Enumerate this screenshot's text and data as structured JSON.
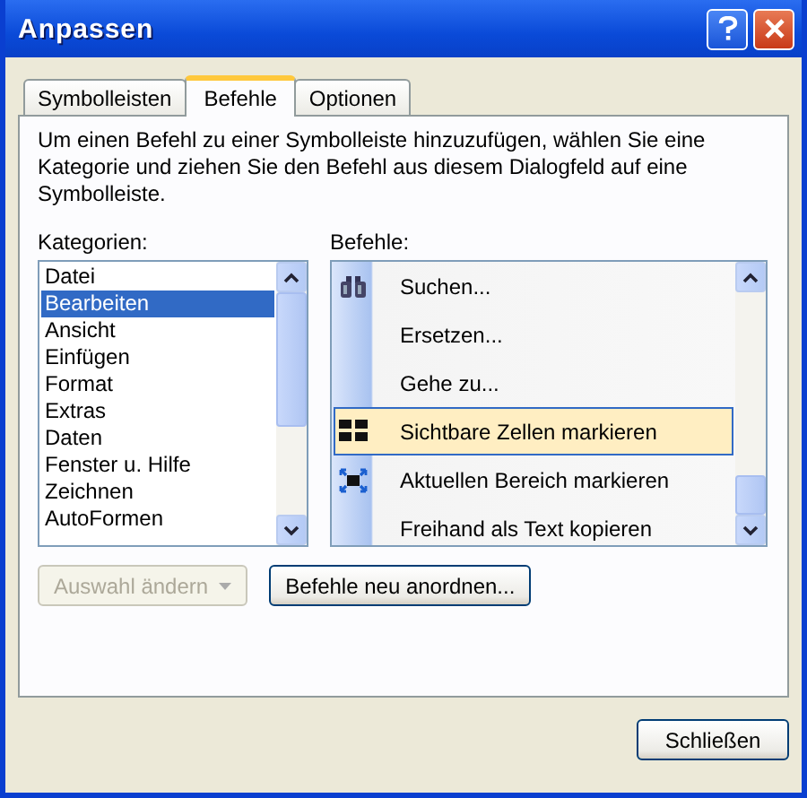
{
  "window": {
    "title": "Anpassen"
  },
  "tabs": [
    {
      "label": "Symbolleisten",
      "selected": false
    },
    {
      "label": "Befehle",
      "selected": true
    },
    {
      "label": "Optionen",
      "selected": false
    }
  ],
  "description": "Um einen Befehl zu einer Symbolleiste hinzuzufügen, wählen Sie eine Kategorie und ziehen Sie den Befehl aus diesem Dialogfeld auf eine Symbolleiste.",
  "categories": {
    "label": "Kategorien:",
    "items": [
      {
        "label": "Datei",
        "selected": false
      },
      {
        "label": "Bearbeiten",
        "selected": true
      },
      {
        "label": "Ansicht",
        "selected": false
      },
      {
        "label": "Einfügen",
        "selected": false
      },
      {
        "label": "Format",
        "selected": false
      },
      {
        "label": "Extras",
        "selected": false
      },
      {
        "label": "Daten",
        "selected": false
      },
      {
        "label": "Fenster u. Hilfe",
        "selected": false
      },
      {
        "label": "Zeichnen",
        "selected": false
      },
      {
        "label": "AutoFormen",
        "selected": false
      }
    ]
  },
  "commands": {
    "label": "Befehle:",
    "items": [
      {
        "label": "Suchen...",
        "kind": "binoculars",
        "selected": false
      },
      {
        "label": "Ersetzen...",
        "kind": "plain",
        "selected": false
      },
      {
        "label": "Gehe zu...",
        "kind": "plain",
        "selected": false
      },
      {
        "label": "Sichtbare Zellen markieren",
        "kind": "cells",
        "selected": true
      },
      {
        "label": "Aktuellen Bereich markieren",
        "kind": "range",
        "selected": false
      },
      {
        "label": "Freihand als Text kopieren",
        "kind": "plain",
        "selected": false
      }
    ]
  },
  "buttons": [
    {
      "label": "Auswahl ändern",
      "kind": "dropdown",
      "disabled": true
    },
    {
      "label": "Befehle neu anordnen...",
      "kind": "push",
      "disabled": false
    }
  ],
  "close_button": "Schließen"
}
